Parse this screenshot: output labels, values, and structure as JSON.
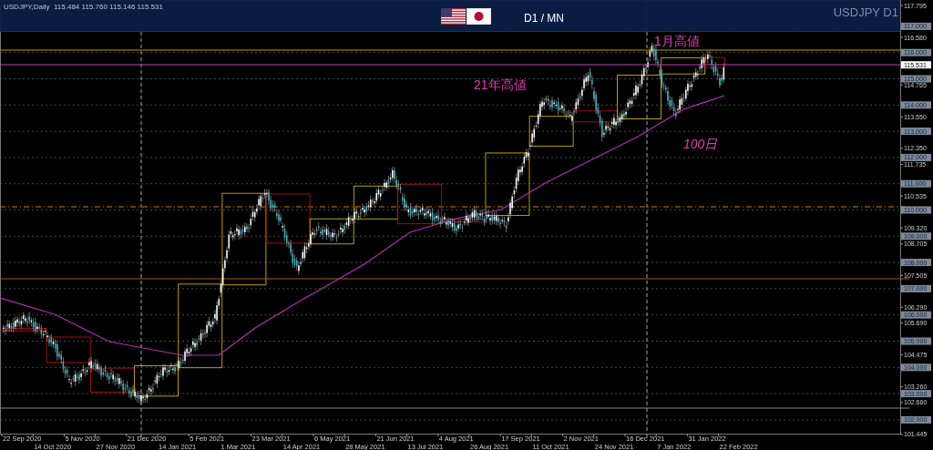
{
  "header": {
    "symbol_info": "USDJPY,Daily  115.484 115.760 115.146 115.531",
    "timeframe": "D1 / MN",
    "symbol_label": "USDJPY D1"
  },
  "annotations": [
    {
      "text": "1月高値"
    },
    {
      "text": "21年高値"
    },
    {
      "text": "100日"
    }
  ],
  "price_axis": [
    {
      "text": "117.795",
      "kind": "tick"
    },
    {
      "text": "117.000",
      "kind": "level"
    },
    {
      "text": "116.580",
      "kind": "tick"
    },
    {
      "text": "116.000",
      "kind": "level"
    },
    {
      "text": "115.531",
      "kind": "current"
    },
    {
      "text": "115.000",
      "kind": "level"
    },
    {
      "text": "114.765",
      "kind": "tick"
    },
    {
      "text": "114.000",
      "kind": "level"
    },
    {
      "text": "113.550",
      "kind": "tick"
    },
    {
      "text": "113.000",
      "kind": "level"
    },
    {
      "text": "112.350",
      "kind": "tick"
    },
    {
      "text": "112.000",
      "kind": "level"
    },
    {
      "text": "111.735",
      "kind": "tick"
    },
    {
      "text": "111.000",
      "kind": "level"
    },
    {
      "text": "110.535",
      "kind": "tick"
    },
    {
      "text": "110.000",
      "kind": "level"
    },
    {
      "text": "109.320",
      "kind": "tick"
    },
    {
      "text": "109.000",
      "kind": "level"
    },
    {
      "text": "108.705",
      "kind": "tick"
    },
    {
      "text": "108.000",
      "kind": "level"
    },
    {
      "text": "107.505",
      "kind": "tick"
    },
    {
      "text": "107.000",
      "kind": "level"
    },
    {
      "text": "106.290",
      "kind": "tick"
    },
    {
      "text": "106.000",
      "kind": "level"
    },
    {
      "text": "105.690",
      "kind": "tick"
    },
    {
      "text": "105.000",
      "kind": "level"
    },
    {
      "text": "104.475",
      "kind": "tick"
    },
    {
      "text": "104.000",
      "kind": "level"
    },
    {
      "text": "103.260",
      "kind": "tick"
    },
    {
      "text": "103.000",
      "kind": "level"
    },
    {
      "text": "102.660",
      "kind": "tick"
    },
    {
      "text": "102.000",
      "kind": "level"
    },
    {
      "text": "101.445",
      "kind": "tick"
    }
  ],
  "date_axis": [
    "22 Sep 2020",
    "14 Oct 2020",
    "5 Nov 2020",
    "27 Nov 2020",
    "21 Dec 2020",
    "14 Jan 2021",
    "5 Feb 2021",
    "1 Mar 2021",
    "23 Mar 2021",
    "14 Apr 2021",
    "6 May 2021",
    "28 May 2021",
    "21 Jun 2021",
    "13 Jul 2021",
    "4 Aug 2021",
    "26 Aug 2021",
    "17 Sep 2021",
    "11 Oct 2021",
    "2 Nov 2021",
    "24 Nov 2021",
    "16 Dec 2021",
    "7 Jan 2022",
    "31 Jan 2022",
    "22 Feb 2022"
  ]
}
